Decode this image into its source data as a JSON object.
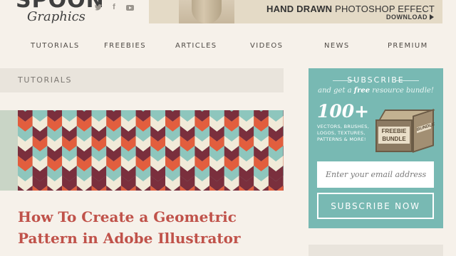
{
  "logo": {
    "main": "SPOON",
    "script": "Graphics"
  },
  "social": {
    "twitter_icon": "twitter-icon",
    "facebook_icon": "facebook-icon",
    "youtube_icon": "youtube-icon"
  },
  "banner": {
    "title_bold": "HAND DRAWN",
    "title_rest": " PHOTOSHOP EFFECT",
    "download": "DOWNLOAD"
  },
  "nav": {
    "items": [
      "TUTORIALS",
      "FREEBIES",
      "ARTICLES",
      "VIDEOS",
      "NEWS",
      "PREMIUM"
    ]
  },
  "category": {
    "label": "TUTORIALS"
  },
  "post": {
    "title": "How To Create a Geometric Pattern in Adobe Illustrator"
  },
  "subscribe": {
    "heading": "SUBSCRIBE",
    "tag_before": "and get a ",
    "tag_free": "free",
    "tag_after": " resource bundle!",
    "count": "100+",
    "description": "VECTORS, BRUSHES, LOGOS, TEXTURES, PATTERNS & MORE!",
    "box_label": "FREEBIE BUNDLE",
    "box_side": "BUNDLE",
    "email_placeholder": "Enter your email address",
    "button": "SUBSCRIBE NOW"
  },
  "colors": {
    "background": "#f6f1ea",
    "accent_title": "#c0524a",
    "teal": "#78b9b3",
    "pattern": [
      "#7a2f3d",
      "#e25e3e",
      "#8ec6bd",
      "#f1ead8"
    ]
  }
}
